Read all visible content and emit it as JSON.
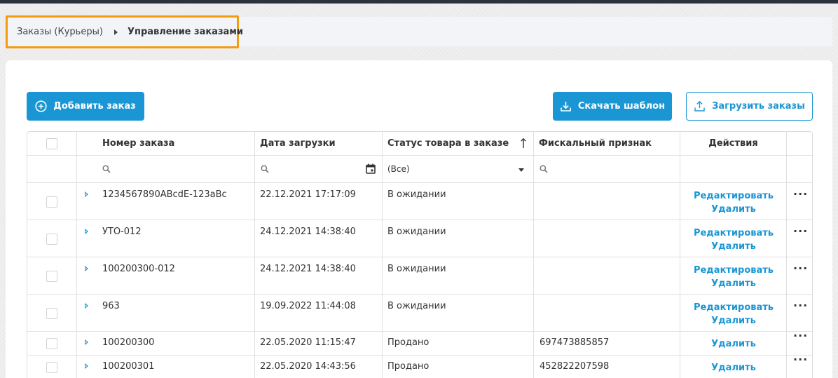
{
  "breadcrumb": {
    "parent": "Заказы (Курьеры)",
    "current": "Управление заказами"
  },
  "toolbar": {
    "add_order": "Добавить заказ",
    "download_template": "Скачать шаблон",
    "upload_orders": "Загрузить заказы"
  },
  "table": {
    "headers": {
      "order_number": "Номер заказа",
      "upload_date": "Дата загрузки",
      "item_status": "Статус товара в заказе",
      "fiscal_sign": "Фискальный признак",
      "actions": "Действия"
    },
    "filters": {
      "status_selected": "(Все)"
    },
    "action_labels": {
      "edit": "Редактировать",
      "delete": "Удалить"
    },
    "more_glyph": "···",
    "rows": [
      {
        "order_number": "1234567890ABcdE-123aBc",
        "date": "22.12.2021 17:17:09",
        "status": "В ожидании",
        "fiscal": ""
      },
      {
        "order_number": "УТО-012",
        "date": "24.12.2021 14:38:40",
        "status": "В ожидании",
        "fiscal": ""
      },
      {
        "order_number": "100200300-012",
        "date": "24.12.2021 14:38:40",
        "status": "В ожидании",
        "fiscal": ""
      },
      {
        "order_number": "963",
        "date": "19.09.2022 11:44:08",
        "status": "В ожидании",
        "fiscal": ""
      },
      {
        "order_number": "100200300",
        "date": "22.05.2020 11:15:47",
        "status": "Продано",
        "fiscal": "697473885857"
      },
      {
        "order_number": "100200301",
        "date": "22.05.2020 14:43:56",
        "status": "Продано",
        "fiscal": "452822207598"
      }
    ]
  },
  "colors": {
    "accent": "#1a96d4",
    "highlight": "#f39c12",
    "topbar": "#2c323c"
  }
}
